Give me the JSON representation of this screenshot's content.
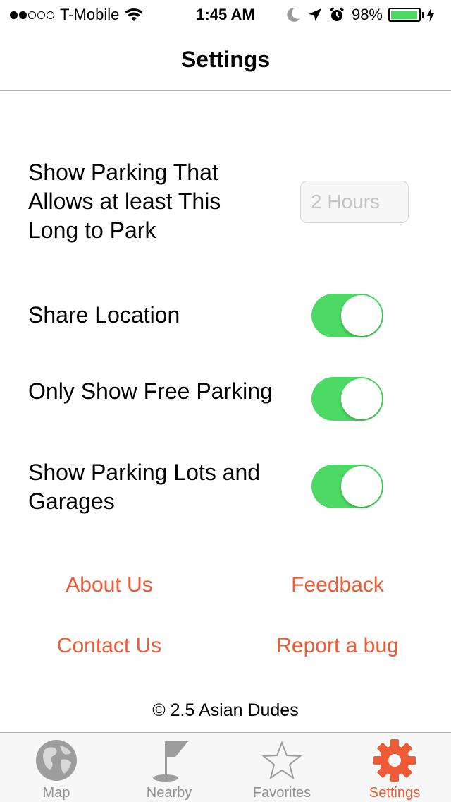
{
  "status_bar": {
    "carrier": "T-Mobile",
    "time": "1:45 AM",
    "battery": "98%",
    "battery_level": 0.98,
    "signal_bars_filled": 2,
    "signal_bars_total": 5,
    "icons": [
      "wifi-icon",
      "moon-icon",
      "location-arrow-icon",
      "alarm-icon",
      "battery-icon",
      "charging-bolt-icon"
    ]
  },
  "nav": {
    "title": "Settings"
  },
  "settings": {
    "parking_duration": {
      "label_line1": "Show Parking That",
      "label_line2": "Allows  at least This",
      "label_line3": "Long to Park",
      "placeholder": "2 Hours"
    },
    "share_location": {
      "label": "Share Location",
      "on": true
    },
    "free_parking": {
      "label": "Only Show Free Parking",
      "on": true
    },
    "lots_garages": {
      "label_line1": "Show Parking Lots and",
      "label_line2": "Garages",
      "on": true
    }
  },
  "links": {
    "about": "About Us",
    "feedback": "Feedback",
    "contact": "Contact Us",
    "report": "Report a bug"
  },
  "footer": {
    "copyright": "© 2.5 Asian Dudes"
  },
  "tabs": [
    {
      "label": "Map",
      "icon": "globe-icon",
      "active": false
    },
    {
      "label": "Nearby",
      "icon": "flag-icon",
      "active": false
    },
    {
      "label": "Favorites",
      "icon": "star-icon",
      "active": false
    },
    {
      "label": "Settings",
      "icon": "gear-icon",
      "active": true
    }
  ],
  "colors": {
    "accent": "#ef5b36",
    "toggle_on": "#4cd964",
    "tab_inactive": "#929292"
  }
}
